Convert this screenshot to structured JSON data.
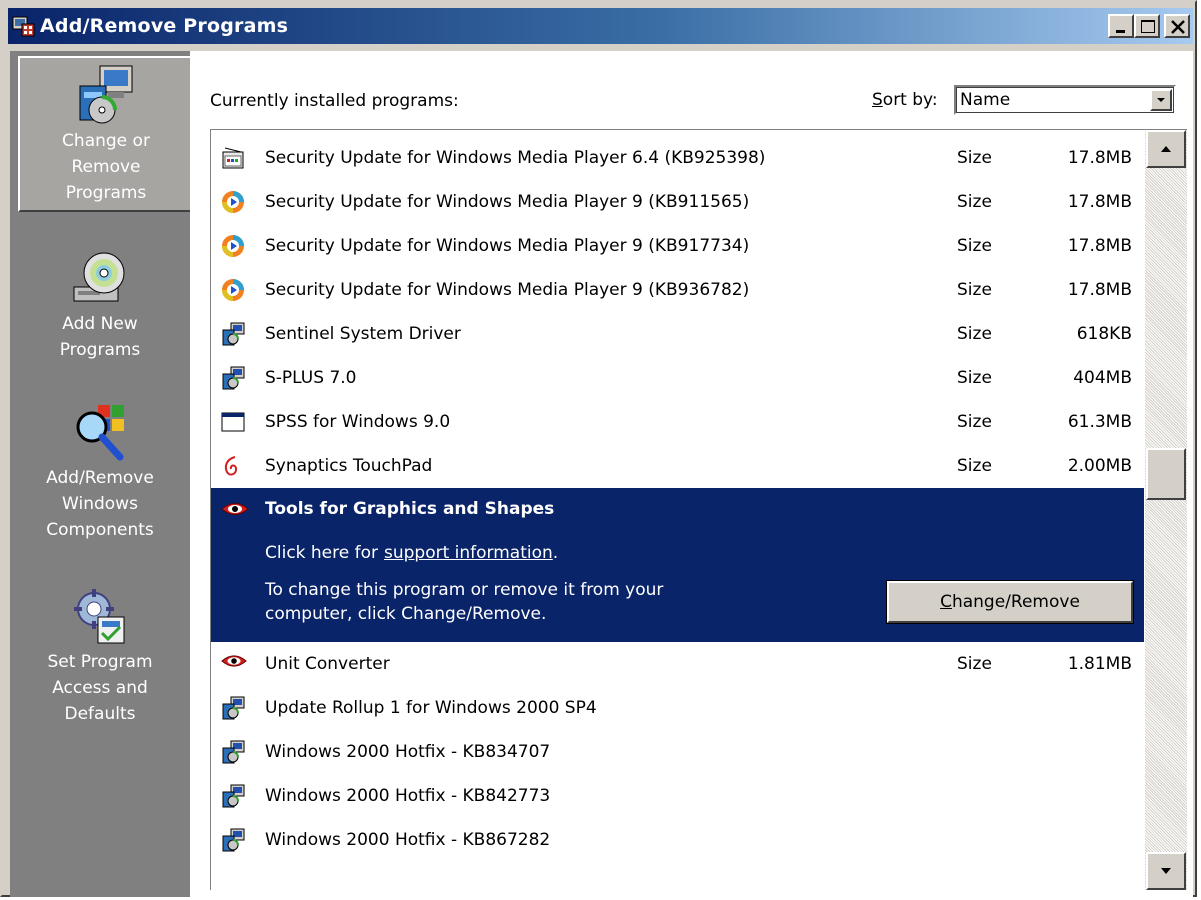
{
  "window": {
    "title": "Add/Remove Programs"
  },
  "sidebar": {
    "items": [
      {
        "label_lines": [
          "Change or",
          "Remove",
          "Programs"
        ],
        "icon": "change-remove-programs-icon",
        "selected": true
      },
      {
        "label_lines": [
          "Add New",
          "Programs"
        ],
        "icon": "add-new-programs-icon",
        "selected": false
      },
      {
        "label_lines": [
          "Add/Remove",
          "Windows",
          "Components"
        ],
        "icon": "windows-components-icon",
        "selected": false
      },
      {
        "label_lines": [
          "Set Program",
          "Access and",
          "Defaults"
        ],
        "icon": "program-access-defaults-icon",
        "selected": false
      }
    ]
  },
  "main": {
    "currently_installed_label": "Currently installed programs:",
    "sort_by_label_accel": "S",
    "sort_by_label_rest": "ort by:",
    "sort_by_value": "Name",
    "size_label": "Size",
    "programs_before": [
      {
        "name": "Security Update for Windows Media Player 6.4 (KB925398)",
        "size": "17.8MB",
        "icon": "media-player-6-icon"
      },
      {
        "name": "Security Update for Windows Media Player 9 (KB911565)",
        "size": "17.8MB",
        "icon": "media-player-9-icon"
      },
      {
        "name": "Security Update for Windows Media Player 9 (KB917734)",
        "size": "17.8MB",
        "icon": "media-player-9-icon"
      },
      {
        "name": "Security Update for Windows Media Player 9 (KB936782)",
        "size": "17.8MB",
        "icon": "media-player-9-icon"
      },
      {
        "name": "Sentinel System Driver",
        "size": "618KB",
        "icon": "installer-box-icon"
      },
      {
        "name": "S-PLUS 7.0",
        "size": "404MB",
        "icon": "installer-box-icon"
      },
      {
        "name": "SPSS for Windows 9.0",
        "size": "61.3MB",
        "icon": "window-app-icon"
      },
      {
        "name": "Synaptics TouchPad",
        "size": "2.00MB",
        "icon": "synaptics-icon"
      }
    ],
    "selected_program": {
      "name": "Tools for Graphics and Shapes",
      "help_prefix": "Click here for",
      "help_link": "support information",
      "help_suffix": ".",
      "description_line1": "To change this program or remove it from your",
      "description_line2": "computer, click Change/Remove.",
      "button_accel": "C",
      "button_rest": "hange/Remove",
      "icon": "red-eye-icon"
    },
    "programs_after": [
      {
        "name": "Unit Converter",
        "size": "1.81MB",
        "icon": "red-eye-icon"
      },
      {
        "name": "Update Rollup 1 for Windows 2000 SP4",
        "size": "",
        "icon": "installer-box-icon"
      },
      {
        "name": "Windows 2000 Hotfix - KB834707",
        "size": "",
        "icon": "installer-box-icon"
      },
      {
        "name": "Windows 2000 Hotfix - KB842773",
        "size": "",
        "icon": "installer-box-icon"
      },
      {
        "name": "Windows 2000 Hotfix - KB867282",
        "size": "",
        "icon": "installer-box-icon"
      }
    ]
  },
  "colors": {
    "title_gradient_start": "#0a246a",
    "title_gradient_end": "#a6caf0",
    "selection_bg": "#0a246a",
    "sidebar_bg": "#808080",
    "face": "#d4d0c8"
  }
}
